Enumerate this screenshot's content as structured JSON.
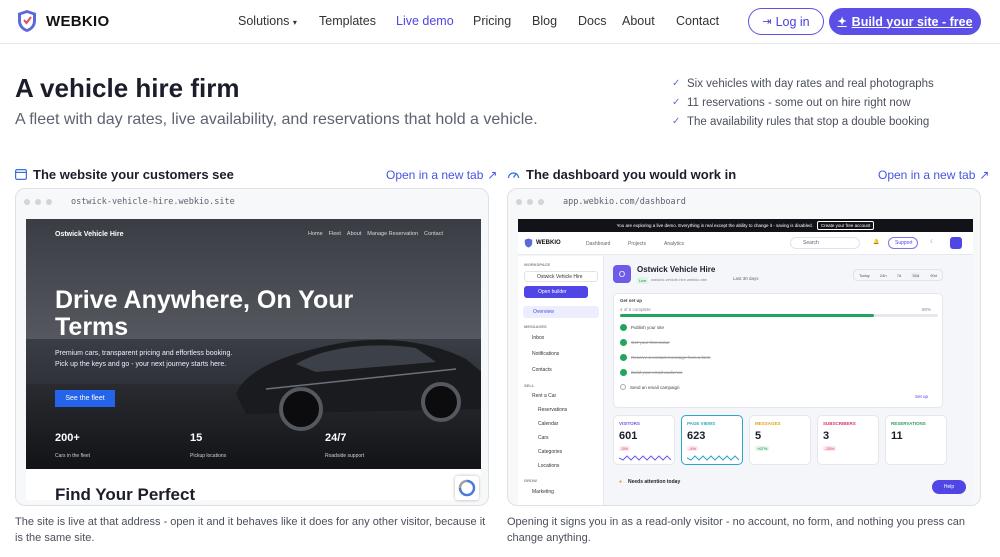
{
  "nav": {
    "brand": "WEBKIO",
    "links": [
      "Solutions",
      "Templates",
      "Live demo",
      "Pricing",
      "Blog",
      "Docs",
      "About",
      "Contact"
    ],
    "login": "Log in",
    "cta": "Build your site - free",
    "active_color": "#4f46e5"
  },
  "hero": {
    "title": "A vehicle hire firm",
    "subtitle": "A fleet with day rates, live availability, and reservations that hold a vehicle.",
    "bullets": [
      "Six vehicles with day rates and real photographs",
      "11 reservations - some out on hire right now",
      "The availability rules that stop a double booking"
    ]
  },
  "left": {
    "heading": "The website your customers see",
    "open": "Open in a new tab",
    "url": "ostwick-vehicle-hire.webkio.site",
    "caption": "The site is live at that address - open it and it behaves like it does for any other visitor, because it is the same site.",
    "site": {
      "brand": "Ostwick Vehicle Hire",
      "menu": [
        "Home",
        "Fleet",
        "About",
        "Manage Reservation",
        "Contact"
      ],
      "title": "Drive Anywhere, On Your Terms",
      "copy": "Premium cars, transparent pricing and effortless booking. Pick up the keys and go - your next journey starts here.",
      "button": "See the fleet",
      "stats": [
        {
          "value": "200+",
          "label": "Cars in the fleet"
        },
        {
          "value": "15",
          "label": "Pickup locations"
        },
        {
          "value": "24/7",
          "label": "Roadside support"
        }
      ],
      "next_heading": "Find Your Perfect"
    }
  },
  "right": {
    "heading": "The dashboard you would work in",
    "open": "Open in a new tab",
    "url": "app.webkio.com/dashboard",
    "caption": "Opening it signs you in as a read-only visitor - no account, no form, and nothing you press can change anything.",
    "dash": {
      "banner": "You are exploring a live demo. Everything is real except the ability to change it - saving is disabled.",
      "banner_button": "Create your free account",
      "brand": "WEBKIO",
      "tabs": [
        "Dashboard",
        "Projects",
        "Analytics"
      ],
      "search": "Search",
      "support": "Support",
      "workspace": "WORKSPACE",
      "site_name": "Ostwick Vehicle Hire",
      "open_builder": "Open builder",
      "overview": "Overview",
      "messages_hd": "MESSAGES",
      "inbox": "Inbox",
      "notifications": "Notifications",
      "contacts": "Contacts",
      "sell_hd": "SELL",
      "rent": "Rent a Car",
      "rent_items": [
        "Reservations",
        "Calendar",
        "Cars",
        "Categories",
        "Locations"
      ],
      "grow_hd": "GROW",
      "marketing": "Marketing",
      "avatar": "O",
      "title": "Ostwick Vehicle Hire",
      "live": "Live",
      "domain": "ostwick-vehicle-hire.webkio.site",
      "period": "Last 30 days",
      "ranges": [
        "Today",
        "24h",
        "7d",
        "30d",
        "90d"
      ],
      "setup_title": "Get set up",
      "setup_progress": "4 of 5 complete",
      "setup_pct": "80%",
      "setup_fraction": 0.8,
      "tasks": [
        "Publish your site",
        "Get your first visitor",
        "Receive a contact message from a form",
        "Build your email audience",
        "Send an email campaign"
      ],
      "set_up": "Set up",
      "kpis": [
        {
          "label": "VISITORS",
          "value": "601",
          "delta": "-5%",
          "color": "#6d5ce8"
        },
        {
          "label": "PAGE VIEWS",
          "value": "623",
          "delta": "-4%",
          "color": "#2aa6c9"
        },
        {
          "label": "MESSAGES",
          "value": "5",
          "delta": "+67%",
          "color": "#e0a21e"
        },
        {
          "label": "SUBSCRIBERS",
          "value": "3",
          "delta": "-25%",
          "color": "#d9366a"
        },
        {
          "label": "RESERVATIONS",
          "value": "11",
          "delta": "",
          "color": "#2f9e5f"
        }
      ],
      "attention": "Needs attention today",
      "help": "Help"
    }
  }
}
